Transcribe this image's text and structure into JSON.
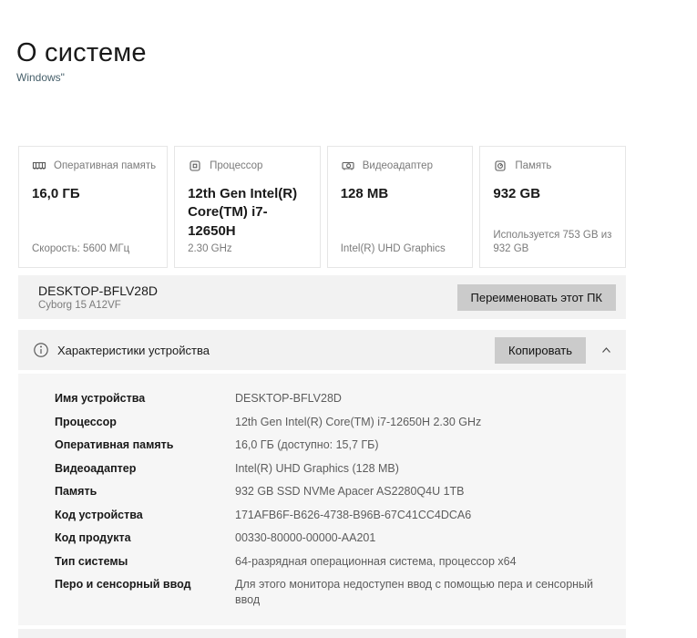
{
  "page": {
    "title": "О системе",
    "subtitle": "Windows\""
  },
  "cards": [
    {
      "icon": "ram-icon",
      "label": "Оперативная память",
      "value": "16,0 ГБ",
      "footer": "Скорость: 5600 МГц"
    },
    {
      "icon": "cpu-icon",
      "label": "Процессор",
      "value": "12th Gen Intel(R) Core(TM) i7-12650H",
      "footer": "2.30 GHz"
    },
    {
      "icon": "gpu-icon",
      "label": "Видеоадаптер",
      "value": "128 MB",
      "footer": "Intel(R) UHD Graphics"
    },
    {
      "icon": "storage-icon",
      "label": "Память",
      "value": "932 GB",
      "footer": "Используется 753 GB из 932 GB"
    }
  ],
  "device": {
    "name": "DESKTOP-BFLV28D",
    "model": "Cyborg 15 A12VF",
    "rename_button": "Переименовать этот ПК"
  },
  "specs": {
    "header": "Характеристики устройства",
    "copy_button": "Копировать",
    "rows": [
      {
        "label": "Имя устройства",
        "value": "DESKTOP-BFLV28D"
      },
      {
        "label": "Процессор",
        "value": "12th Gen Intel(R) Core(TM) i7-12650H   2.30 GHz"
      },
      {
        "label": "Оперативная память",
        "value": "16,0 ГБ (доступно: 15,7 ГБ)"
      },
      {
        "label": "Видеоадаптер",
        "value": "Intel(R) UHD Graphics (128 MB)"
      },
      {
        "label": "Память",
        "value": "932 GB SSD NVMe Apacer AS2280Q4U 1TB"
      },
      {
        "label": "Код устройства",
        "value": "171AFB6F-B626-4738-B96B-67C41CC4DCA6"
      },
      {
        "label": "Код продукта",
        "value": "00330-80000-00000-AA201"
      },
      {
        "label": "Тип системы",
        "value": "64-разрядная операционная система, процессор x64"
      },
      {
        "label": "Перо и сенсорный ввод",
        "value": "Для этого монитора недоступен ввод с помощью пера и сенсорный ввод"
      }
    ]
  },
  "colors": {
    "row_background": "#f2f2f2",
    "panel_background": "#f6f6f6",
    "button_background": "#cbcbcb",
    "card_border": "#e6e6e6",
    "subtitle_text": "#47606b",
    "secondary_text": "#7b7b7b"
  }
}
